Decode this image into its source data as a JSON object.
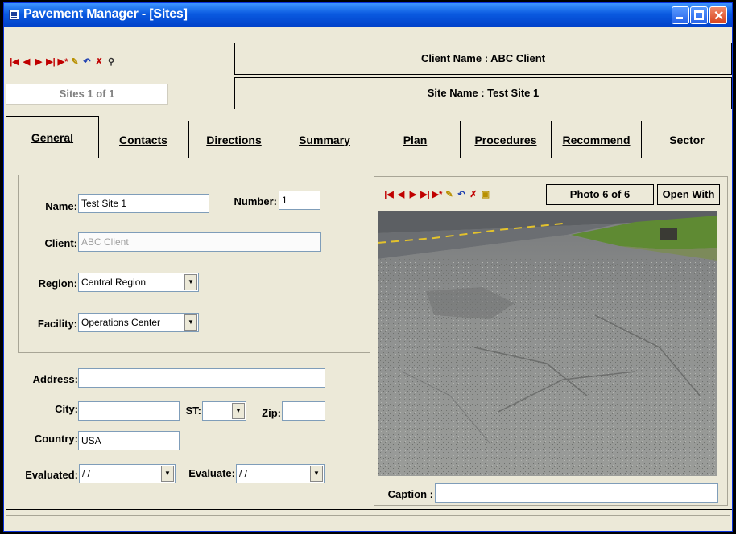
{
  "window": {
    "title": "Pavement Manager - [Sites]"
  },
  "record_nav": {
    "counter": "Sites 1 of 1"
  },
  "header": {
    "client_name": "Client Name : ABC Client",
    "site_name": "Site Name : Test Site 1"
  },
  "tabs": [
    {
      "label": "General",
      "active": true
    },
    {
      "label": "Contacts"
    },
    {
      "label": "Directions"
    },
    {
      "label": "Summary"
    },
    {
      "label": "Plan"
    },
    {
      "label": "Procedures"
    },
    {
      "label": "Recommend"
    },
    {
      "label": "Sector"
    }
  ],
  "form": {
    "name_label": "Name:",
    "name_value": "Test Site 1",
    "number_label": "Number:",
    "number_value": "1",
    "client_label": "Client:",
    "client_value": "ABC Client",
    "region_label": "Region:",
    "region_value": "Central Region",
    "facility_label": "Facility:",
    "facility_value": "Operations Center",
    "address_label": "Address:",
    "address_value": "",
    "city_label": "City:",
    "city_value": "",
    "st_label": "ST:",
    "st_value": "",
    "zip_label": "Zip:",
    "zip_value": "",
    "country_label": "Country:",
    "country_value": "USA",
    "evaluated_label": "Evaluated:",
    "evaluated_value": " / /",
    "evaluate_label": "Evaluate:",
    "evaluate_value": " / /"
  },
  "photo": {
    "counter": "Photo   6 of 6",
    "open_with": "Open With",
    "caption_label": "Caption :",
    "caption_value": ""
  },
  "icons": [
    "first-record-icon",
    "prev-record-icon",
    "next-record-icon",
    "last-record-icon",
    "new-record-icon",
    "save-record-icon",
    "undo-icon",
    "delete-record-icon",
    "find-icon",
    "open-folder-icon"
  ]
}
